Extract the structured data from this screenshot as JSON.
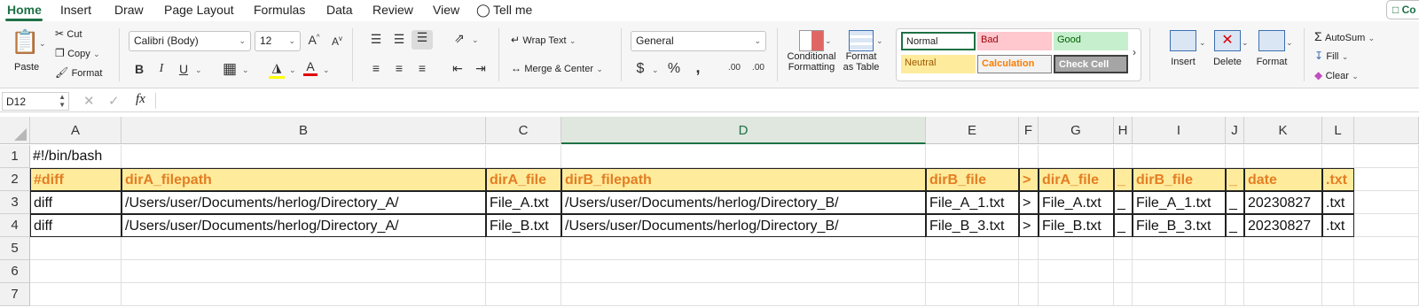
{
  "tabs": [
    "Home",
    "Insert",
    "Draw",
    "Page Layout",
    "Formulas",
    "Data",
    "Review",
    "View",
    "Tell me"
  ],
  "comment_button": "Co",
  "clipboard": {
    "paste": "Paste",
    "cut": "Cut",
    "copy": "Copy",
    "format": "Format"
  },
  "font": {
    "name": "Calibri (Body)",
    "size": "12"
  },
  "alignment": {
    "wrap_text": "Wrap Text",
    "merge_center": "Merge & Center"
  },
  "number": {
    "format": "General",
    "currency": "$",
    "percent": "%",
    "comma": ",",
    "inc_decimal": ".00",
    "dec_decimal": ".00"
  },
  "styles": {
    "conditional": "Conditional Formatting",
    "conditional_line1": "Conditional",
    "conditional_line2": "Formatting",
    "format_table_line1": "Format",
    "format_table_line2": "as Table",
    "cells": [
      {
        "label": "Normal",
        "bg": "#ffffff",
        "fg": "#222222"
      },
      {
        "label": "Bad",
        "bg": "#ffc7ce",
        "fg": "#9c0006"
      },
      {
        "label": "Good",
        "bg": "#c6efce",
        "fg": "#006100"
      },
      {
        "label": "Neutral",
        "bg": "#ffeb9c",
        "fg": "#9c5700"
      },
      {
        "label": "Calculation",
        "bg": "#f2f2f2",
        "fg": "#fa7d00"
      },
      {
        "label": "Check Cell",
        "bg": "#a5a5a5",
        "fg": "#ffffff"
      }
    ]
  },
  "cells_group": {
    "insert": "Insert",
    "delete": "Delete",
    "format": "Format"
  },
  "editing": {
    "autosum": "AutoSum",
    "fill": "Fill",
    "clear": "Clear"
  },
  "formula_bar": {
    "name_box": "D12",
    "fx": "fx",
    "formula": ""
  },
  "sheet": {
    "columns": [
      "A",
      "B",
      "C",
      "D",
      "E",
      "F",
      "G",
      "H",
      "I",
      "J",
      "K",
      "L"
    ],
    "selected_column": "D",
    "rows": [
      "1",
      "2",
      "3",
      "4",
      "5",
      "6",
      "7"
    ],
    "cells": [
      [
        "#!/bin/bash",
        "",
        "",
        "",
        "",
        "",
        "",
        "",
        "",
        "",
        "",
        ""
      ],
      [
        "#diff",
        "dirA_filepath",
        "dirA_file",
        "dirB_filepath",
        "dirB_file",
        ">",
        "dirA_file",
        "_",
        "dirB_file",
        "_",
        "date",
        ".txt"
      ],
      [
        "diff",
        "/Users/user/Documents/herlog/Directory_A/",
        "File_A.txt",
        "/Users/user/Documents/herlog/Directory_B/",
        "File_A_1.txt",
        ">",
        "File_A.txt",
        "_",
        "File_A_1.txt",
        "_",
        "20230827",
        ".txt"
      ],
      [
        "diff",
        "/Users/user/Documents/herlog/Directory_A/",
        "File_B.txt",
        "/Users/user/Documents/herlog/Directory_B/",
        "File_B_3.txt",
        ">",
        "File_B.txt",
        "_",
        "File_B_3.txt",
        "_",
        "20230827",
        ".txt"
      ],
      [
        "",
        "",
        "",
        "",
        "",
        "",
        "",
        "",
        "",
        "",
        "",
        ""
      ],
      [
        "",
        "",
        "",
        "",
        "",
        "",
        "",
        "",
        "",
        "",
        "",
        ""
      ],
      [
        "",
        "",
        "",
        "",
        "",
        "",
        "",
        "",
        "",
        "",
        "",
        ""
      ]
    ]
  }
}
